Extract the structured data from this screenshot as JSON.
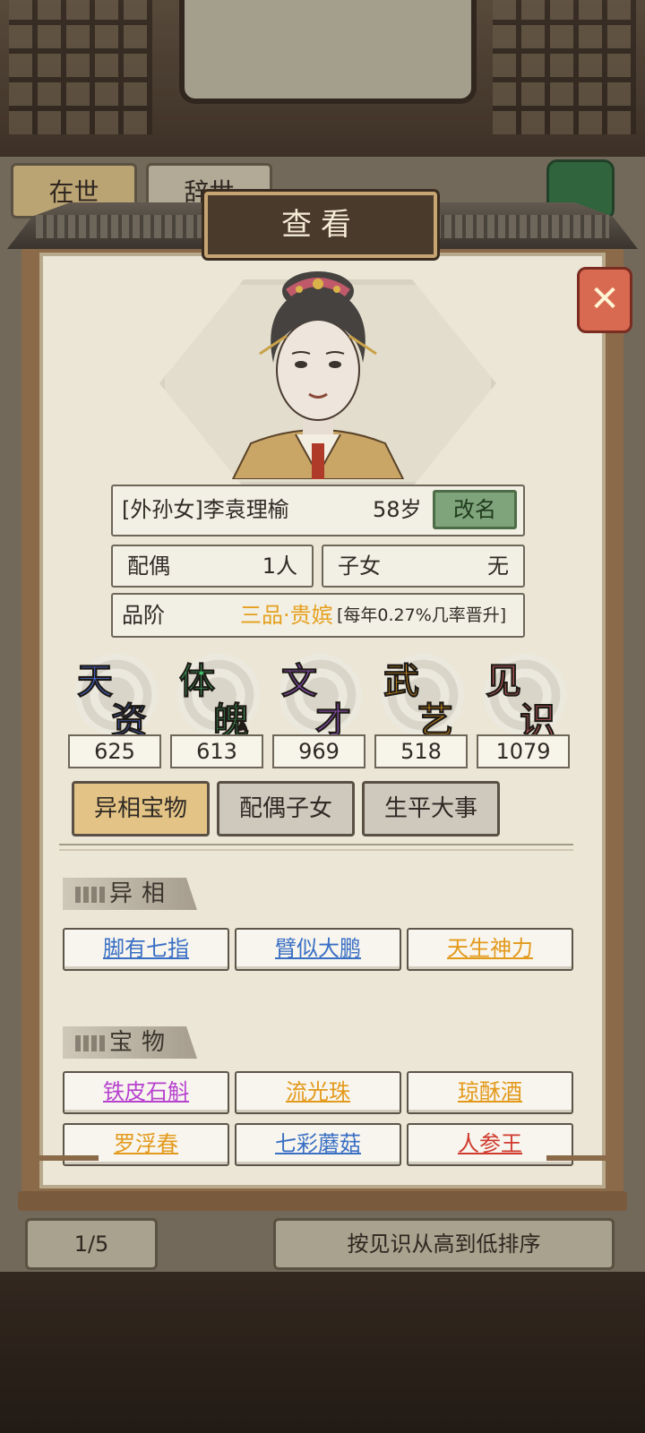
{
  "background": {
    "tabs": [
      "在世",
      "辞世"
    ],
    "pager": "1/5",
    "sort_label": "按见识从高到低排序"
  },
  "dialog": {
    "title": "查看",
    "close_icon": "crossed-swords-close-icon"
  },
  "character": {
    "name": "[外孙女]李袁理榆",
    "age": "58岁",
    "rename_label": "改名",
    "spouse_label": "配偶",
    "spouse_value": "1人",
    "children_label": "子女",
    "children_value": "无",
    "rank_label": "品阶",
    "rank_value": "三品·贵嫔",
    "rank_note": "[每年0.27%几率晋升]"
  },
  "stats": [
    {
      "c1": "天",
      "c2": "资",
      "value": "625",
      "color": "#4a6fe0"
    },
    {
      "c1": "体",
      "c2": "魄",
      "value": "613",
      "color": "#3fbf6a"
    },
    {
      "c1": "文",
      "c2": "才",
      "value": "969",
      "color": "#a45ad6"
    },
    {
      "c1": "武",
      "c2": "艺",
      "value": "518",
      "color": "#f0a21c"
    },
    {
      "c1": "见",
      "c2": "识",
      "value": "1079",
      "color": "#e06a6a"
    }
  ],
  "tabs": [
    "异相宝物",
    "配偶子女",
    "生平大事"
  ],
  "sections": {
    "traits_title": "异相",
    "treasures_title": "宝物"
  },
  "traits": [
    {
      "label": "脚有七指",
      "color": "blue"
    },
    {
      "label": "臂似大鹏",
      "color": "blue"
    },
    {
      "label": "天生神力",
      "color": "orange"
    }
  ],
  "treasures": [
    {
      "label": "铁皮石斛",
      "color": "purple"
    },
    {
      "label": "流光珠",
      "color": "orange"
    },
    {
      "label": "琼酥酒",
      "color": "orange"
    },
    {
      "label": "罗浮春",
      "color": "orange"
    },
    {
      "label": "七彩蘑菇",
      "color": "blue"
    },
    {
      "label": "人参王",
      "color": "red"
    }
  ]
}
